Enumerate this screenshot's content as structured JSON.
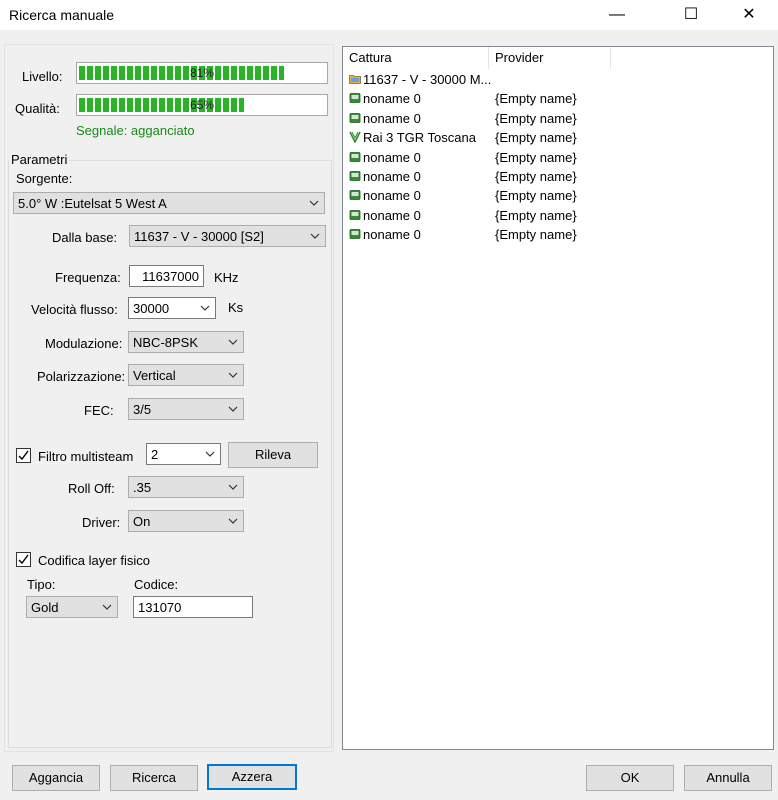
{
  "window": {
    "title": "Ricerca manuale",
    "minimize": "—",
    "maximize": "☐",
    "close": "✕"
  },
  "signal": {
    "level_label": "Livello:",
    "level_pct": "81%",
    "level_value": 81,
    "quality_label": "Qualità:",
    "quality_pct": "65%",
    "quality_value": 65,
    "status": "Segnale: agganciato"
  },
  "params": {
    "group_title": "Parametri",
    "source_label": "Sorgente:",
    "source_value": "5.0° W :Eutelsat 5 West A",
    "base_label": "Dalla base:",
    "base_value": "11637 - V - 30000 [S2]",
    "freq_label": "Frequenza:",
    "freq_value": "11637000",
    "freq_unit": "KHz",
    "rate_label": "Velocità flusso:",
    "rate_value": "30000",
    "rate_unit": "Ks",
    "mod_label": "Modulazione:",
    "mod_value": "NBC-8PSK",
    "pol_label": "Polarizzazione:",
    "pol_value": "Vertical",
    "fec_label": "FEC:",
    "fec_value": "3/5",
    "multistream_label": "Filtro multisteam",
    "multistream_checked": true,
    "multistream_value": "2",
    "detect_button": "Rileva",
    "rolloff_label": "Roll Off:",
    "rolloff_value": ".35",
    "driver_label": "Driver:",
    "driver_value": "On",
    "pls_label": "Codifica layer fisico",
    "pls_checked": true,
    "type_label": "Tipo:",
    "type_value": "Gold",
    "code_label": "Codice:",
    "code_value": "131070"
  },
  "list": {
    "columns": [
      "Cattura",
      "Provider"
    ],
    "rows": [
      {
        "icon": "folder-icon",
        "name": "11637 - V - 30000 M...",
        "provider": ""
      },
      {
        "icon": "tv-channel-icon",
        "name": "noname 0",
        "provider": "{Empty name}"
      },
      {
        "icon": "tv-channel-icon",
        "name": "noname 0",
        "provider": "{Empty name}"
      },
      {
        "icon": "radio-channel-icon",
        "name": "Rai 3 TGR Toscana",
        "provider": "{Empty name}"
      },
      {
        "icon": "tv-channel-icon",
        "name": "noname 0",
        "provider": "{Empty name}"
      },
      {
        "icon": "tv-channel-icon",
        "name": "noname 0",
        "provider": "{Empty name}"
      },
      {
        "icon": "tv-channel-icon",
        "name": "noname 0",
        "provider": "{Empty name}"
      },
      {
        "icon": "tv-channel-icon",
        "name": "noname 0",
        "provider": "{Empty name}"
      },
      {
        "icon": "tv-channel-icon",
        "name": "noname 0",
        "provider": "{Empty name}"
      }
    ]
  },
  "buttons": {
    "lock": "Aggancia",
    "search": "Ricerca",
    "reset": "Azzera",
    "ok": "OK",
    "cancel": "Annulla"
  },
  "colors": {
    "progress_green": "#27b427",
    "status_green": "#178a17",
    "focus_blue": "#0078d7"
  }
}
